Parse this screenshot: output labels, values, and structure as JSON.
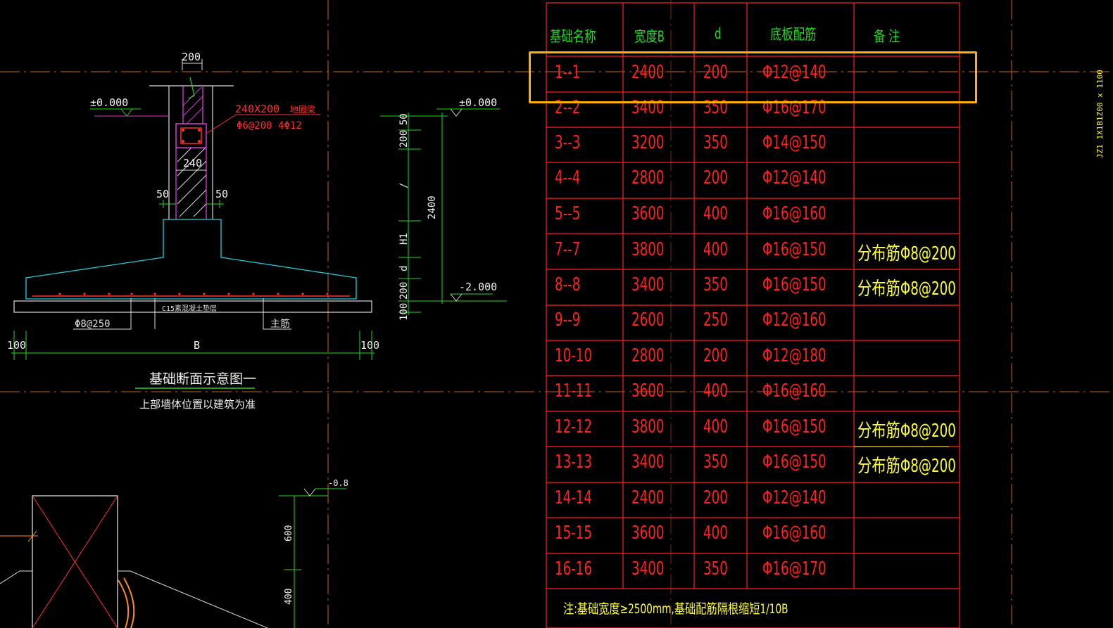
{
  "drawing": {
    "section_title": "基础断面示意图一",
    "section_note": "上部墙体位置以建筑为准",
    "dim_top_width": "200",
    "dim_wall": "240",
    "dim_left_offset": "50",
    "dim_right_offset": "50",
    "dim_edge_left": "100",
    "dim_edge_right": "100",
    "dim_B": "B",
    "level_zero_left": "±0.000",
    "level_zero_right": "±0.000",
    "level_bottom": "-2.000",
    "level_pit": "-0.8",
    "beam_label": "240X200",
    "beam_name": "地圈梁",
    "beam_rebar": "Φ6@200  4Φ12",
    "cushion_label": "C15素混凝土垫层",
    "dist_rebar": "Φ8@250",
    "main_rebar": "主筋",
    "vdim_50": "50",
    "vdim_200a": "200",
    "vdim_slash": "/",
    "vdim_H1": "H1",
    "vdim_d": "d",
    "vdim_200b": "200",
    "vdim_100": "100",
    "vdim_total": "2400",
    "vdim_600": "600",
    "vdim_400": "400",
    "side_text": "JZ1 1X1B1Z00 x 1100"
  },
  "table": {
    "headers": [
      "基础名称",
      "宽度B",
      "d",
      "底板配筋",
      "备   注"
    ],
    "rows": [
      [
        "1--1",
        "2400",
        "200",
        "Φ12@140",
        ""
      ],
      [
        "2--2",
        "3400",
        "350",
        "Φ16@170",
        ""
      ],
      [
        "3--3",
        "3200",
        "350",
        "Φ14@150",
        ""
      ],
      [
        "4--4",
        "2800",
        "200",
        "Φ12@140",
        ""
      ],
      [
        "5--5",
        "3600",
        "400",
        "Φ16@160",
        ""
      ],
      [
        "7--7",
        "3800",
        "400",
        "Φ16@150",
        "分布筋Φ8@200"
      ],
      [
        "8--8",
        "3400",
        "350",
        "Φ16@150",
        "分布筋Φ8@200"
      ],
      [
        "9--9",
        "2600",
        "250",
        "Φ12@160",
        ""
      ],
      [
        "10-10",
        "2800",
        "200",
        "Φ12@180",
        ""
      ],
      [
        "11-11",
        "3600",
        "400",
        "Φ16@160",
        ""
      ],
      [
        "12-12",
        "3800",
        "400",
        "Φ16@150",
        "分布筋Φ8@200"
      ],
      [
        "13-13",
        "3400",
        "350",
        "Φ16@150",
        "分布筋Φ8@200"
      ],
      [
        "14-14",
        "2400",
        "200",
        "Φ12@140",
        ""
      ],
      [
        "15-15",
        "3600",
        "400",
        "Φ16@160",
        ""
      ],
      [
        "16-16",
        "3400",
        "350",
        "Φ16@170",
        ""
      ]
    ],
    "footnote": "注:基础宽度≥2500mm,基础配筋隔根缩短1/10B"
  },
  "colors": {
    "background": "#000000",
    "table_line": "#ff2020",
    "header_text": "#22d622",
    "note_text": "#ffff30",
    "selection": "#ffb300",
    "axis_line": "#ff8c1a"
  }
}
